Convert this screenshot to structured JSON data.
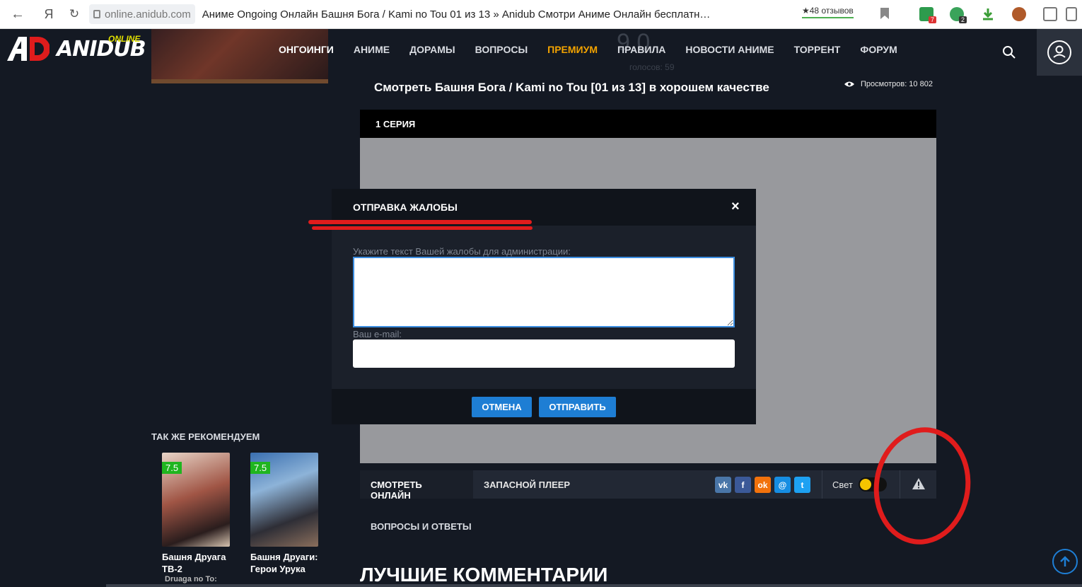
{
  "browser": {
    "domain": "online.anidub.com",
    "page_title": "Аниме Ongoing Онлайн Башня Бога / Kami no Tou 01 из 13 » Anidub Смотри Аниме Онлайн бесплатн…",
    "reviews": "★48 отзывов",
    "ext_badges": [
      "7",
      "2"
    ]
  },
  "logo": {
    "text": "ANIDUB",
    "online": "ONLINE"
  },
  "nav": {
    "items": [
      "ОНГОИНГИ",
      "АНИМЕ",
      "ДОРАМЫ",
      "ВОПРОСЫ",
      "ПРЕМИУМ",
      "ПРАВИЛА",
      "НОВОСТИ АНИМЕ",
      "ТОРРЕНТ",
      "ФОРУМ"
    ],
    "premium_color": "#f3a300"
  },
  "rating": {
    "value": "9.0",
    "votes": "голосов: 59"
  },
  "content": {
    "watch_title": "Смотреть Башня Бога / Kami no Tou [01 из 13] в хорошем качестве",
    "views": "Просмотров: 10 802",
    "episode": "1 СЕРИЯ"
  },
  "player_tabs": {
    "watch_online": "СМОТРЕТЬ ОНЛАЙН",
    "backup_player": "ЗАПАСНОЙ ПЛЕЕР",
    "light": "Свет",
    "faq": "ВОПРОСЫ И ОТВЕТЫ"
  },
  "share": [
    {
      "name": "vk",
      "glyph": "vk",
      "color": "#4a76a8"
    },
    {
      "name": "facebook",
      "glyph": "f",
      "color": "#3b5998"
    },
    {
      "name": "odnoklassniki",
      "glyph": "ok",
      "color": "#f2720c"
    },
    {
      "name": "moimir",
      "glyph": "@",
      "color": "#168de2"
    },
    {
      "name": "twitter",
      "glyph": "t",
      "color": "#1da1f2"
    }
  ],
  "sidebar": {
    "rec_title": "ТАК ЖЕ РЕКОМЕНДУЕМ",
    "cards": [
      {
        "score": "7.5",
        "title": "Башня Друага ТВ-2",
        "sub": "Druaga no To: The"
      },
      {
        "score": "7.5",
        "title": "Башня Друаги: Герои Урука",
        "sub": ""
      }
    ]
  },
  "comments": {
    "title": "ЛУЧШИЕ КОММЕНТАРИИ"
  },
  "modal": {
    "title": "ОТПРАВКА ЖАЛОБЫ",
    "close": "×",
    "complaint_label": "Укажите текст Вашей жалобы для администрации:",
    "email_label": "Ваш e-mail:",
    "complaint_value": "",
    "email_value": "",
    "cancel": "ОТМЕНА",
    "submit": "ОТПРАВИТЬ"
  },
  "colors": {
    "background": "#141923",
    "accent_blue": "#1e7ed4",
    "annotation_red": "#e01c1c",
    "score_green": "#1fb51f"
  }
}
